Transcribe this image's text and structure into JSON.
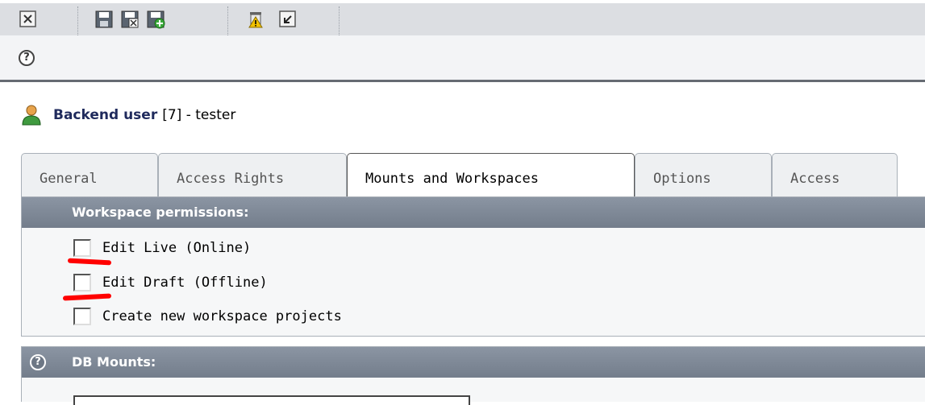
{
  "toolbar": {
    "icons": [
      "close-icon",
      "save-icon",
      "save-close-icon",
      "save-new-icon",
      "delete-icon",
      "undo-icon"
    ]
  },
  "record": {
    "icon": "backend-user-icon",
    "type_label": "Backend user",
    "rest": "[7] - tester"
  },
  "tabs": [
    {
      "label": "General"
    },
    {
      "label": "Access Rights"
    },
    {
      "label": "Mounts and Workspaces",
      "active": true
    },
    {
      "label": "Options"
    },
    {
      "label": "Access"
    }
  ],
  "workspace": {
    "header": "Workspace permissions:",
    "options": [
      {
        "label": "Edit Live (Online)",
        "checked": false
      },
      {
        "label": "Edit Draft (Offline)",
        "checked": false
      },
      {
        "label": "Create new workspace projects",
        "checked": false
      }
    ]
  },
  "db_mounts": {
    "header": "DB Mounts:"
  },
  "colors": {
    "accent": "#1f2a5c",
    "annotation": "#ff0000"
  }
}
